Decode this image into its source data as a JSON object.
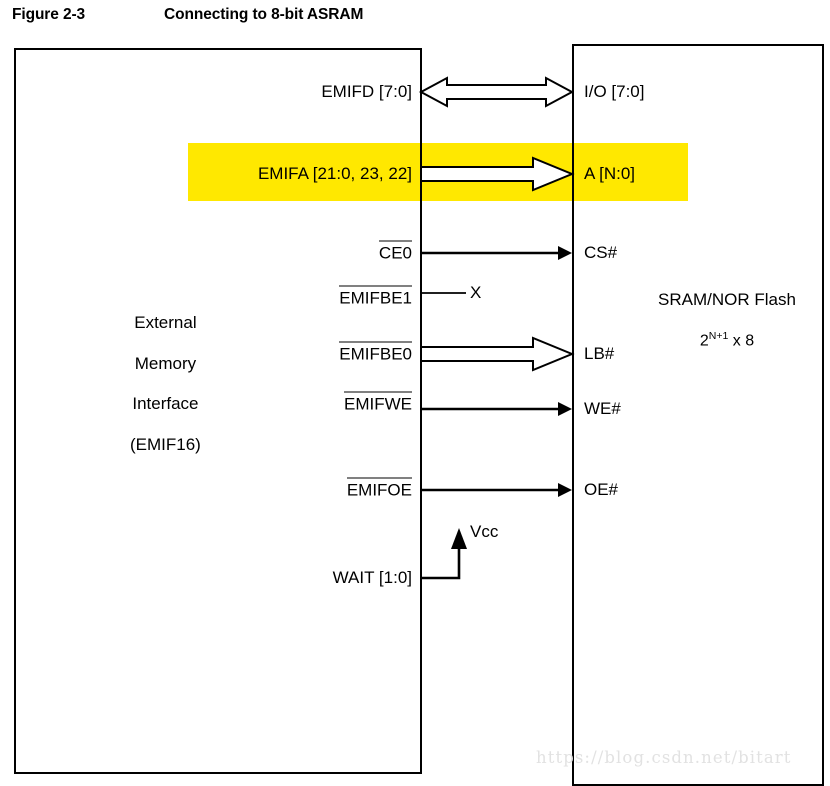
{
  "figure": {
    "number": "Figure 2-3",
    "title": "Connecting to 8-bit ASRAM"
  },
  "blocks": {
    "left": {
      "name": "External Memory Interface",
      "lines": [
        "External",
        "Memory",
        "Interface",
        "(EMIF16)"
      ]
    },
    "right": {
      "name": "SRAM/NOR Flash",
      "title": "SRAM/NOR Flash",
      "capacity_base": "2",
      "capacity_exponent": "N+1",
      "capacity_suffix": " x 8"
    }
  },
  "signals": [
    {
      "id": "data-bus",
      "left_label": "EMIFD [7:0]",
      "right_label": "I/O [7:0]",
      "overbar": false,
      "type": "bus-bidirectional",
      "highlighted": false
    },
    {
      "id": "address-bus",
      "left_label": "EMIFA [21:0, 23, 22]",
      "right_label": "A [N:0]",
      "overbar": false,
      "type": "bus-right",
      "highlighted": true
    },
    {
      "id": "chip-enable",
      "left_label": "CE0",
      "right_label": "CS#",
      "overbar": true,
      "type": "signal-right",
      "highlighted": false
    },
    {
      "id": "byte-enable-1",
      "left_label": "EMIFBE1",
      "right_label": "",
      "overbar": true,
      "type": "stub-unconnected",
      "terminator": "X",
      "highlighted": false
    },
    {
      "id": "byte-enable-0",
      "left_label": "EMIFBE0",
      "right_label": "LB#",
      "overbar": true,
      "type": "bus-right",
      "highlighted": false
    },
    {
      "id": "write-enable",
      "left_label": "EMIFWE",
      "right_label": "WE#",
      "overbar": true,
      "type": "signal-right",
      "highlighted": false
    },
    {
      "id": "output-enable",
      "left_label": "EMIFOE",
      "right_label": "OE#",
      "overbar": true,
      "type": "signal-right",
      "highlighted": false
    },
    {
      "id": "wait",
      "left_label": "WAIT [1:0]",
      "right_label": "",
      "overbar": false,
      "type": "pullup",
      "terminator": "Vcc",
      "highlighted": false
    }
  ],
  "annotations": {
    "vcc": "Vcc",
    "unconnected": "X"
  },
  "colors": {
    "highlight": "#ffe800",
    "line": "#000000",
    "watermark": "#e2e2e2",
    "background": "#ffffff"
  },
  "watermark": "https://blog.csdn.net/bitart"
}
